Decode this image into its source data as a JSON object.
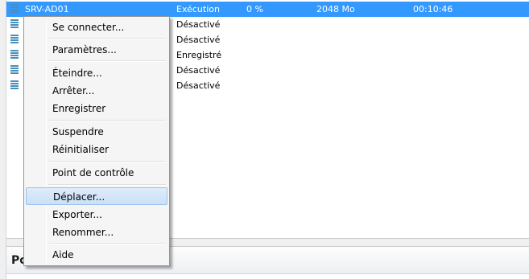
{
  "vm_list": {
    "rows": [
      {
        "name": "SRV-AD01",
        "state": "Exécution",
        "cpu": "0 %",
        "memory": "2048 Mo",
        "uptime": "00:10:46"
      },
      {
        "name": "",
        "state": "Désactivé",
        "cpu": "",
        "memory": "",
        "uptime": ""
      },
      {
        "name": "",
        "state": "Désactivé",
        "cpu": "",
        "memory": "",
        "uptime": ""
      },
      {
        "name": "",
        "state": "Enregistré",
        "cpu": "",
        "memory": "",
        "uptime": ""
      },
      {
        "name": "",
        "state": "Désactivé",
        "cpu": "",
        "memory": "",
        "uptime": ""
      },
      {
        "name": "",
        "state": "Désactivé",
        "cpu": "",
        "memory": "",
        "uptime": ""
      }
    ],
    "selected_row": 0,
    "icon": "virtual-machine-icon"
  },
  "context_menu": {
    "items": [
      {
        "label": "Se connecter..."
      },
      {
        "label": "Paramètres..."
      },
      {
        "label": "Éteindre..."
      },
      {
        "label": "Arrêter..."
      },
      {
        "label": "Enregistrer"
      },
      {
        "label": "Suspendre"
      },
      {
        "label": "Réinitialiser"
      },
      {
        "label": "Point de contrôle"
      },
      {
        "label": "Déplacer..."
      },
      {
        "label": "Exporter..."
      },
      {
        "label": "Renommer..."
      },
      {
        "label": "Aide"
      }
    ],
    "highlighted_item": "Déplacer..."
  },
  "bottom_panel": {
    "title": "Po"
  },
  "colors": {
    "selection": "#3399ff",
    "menu_highlight": "#cbe0f7",
    "menu_background": "#f5f5f5"
  }
}
